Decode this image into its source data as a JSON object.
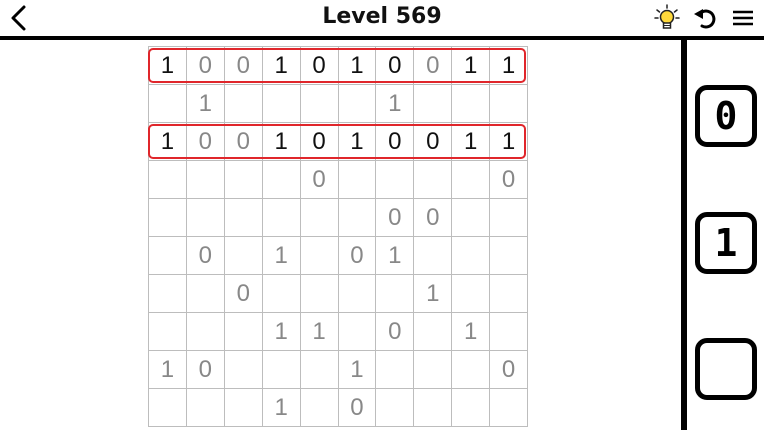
{
  "header": {
    "title": "Level 569",
    "back_icon": "chevron-left-icon",
    "hint_icon": "lightbulb-icon",
    "undo_icon": "undo-icon",
    "menu_icon": "hamburger-menu-icon"
  },
  "grid": {
    "rows": [
      [
        "1",
        "0",
        "0",
        "1",
        "0",
        "1",
        "0",
        "0",
        "1",
        "1"
      ],
      [
        "",
        "1",
        "",
        "",
        "",
        "",
        "1",
        "",
        "",
        ""
      ],
      [
        "1",
        "0",
        "0",
        "1",
        "0",
        "1",
        "0",
        "0",
        "1",
        "1"
      ],
      [
        "",
        "",
        "",
        "",
        "0",
        "",
        "",
        "",
        "",
        "0"
      ],
      [
        "",
        "",
        "",
        "",
        "",
        "",
        "0",
        "0",
        "",
        ""
      ],
      [
        "",
        "0",
        "",
        "1",
        "",
        "0",
        "1",
        "",
        "",
        ""
      ],
      [
        "",
        "",
        "0",
        "",
        "",
        "",
        "",
        "1",
        "",
        ""
      ],
      [
        "",
        "",
        "",
        "1",
        "1",
        "",
        "0",
        "",
        "1",
        ""
      ],
      [
        "1",
        "0",
        "",
        "",
        "",
        "1",
        "",
        "",
        "",
        "0"
      ],
      [
        "",
        "",
        "",
        "1",
        "",
        "0",
        "",
        "",
        "",
        ""
      ]
    ],
    "player_filled": [
      [
        0,
        0
      ],
      [
        0,
        3
      ],
      [
        0,
        4
      ],
      [
        0,
        5
      ],
      [
        0,
        6
      ],
      [
        0,
        8
      ],
      [
        0,
        9
      ],
      [
        2,
        0
      ],
      [
        2,
        3
      ],
      [
        2,
        4
      ],
      [
        2,
        5
      ],
      [
        2,
        6
      ],
      [
        2,
        7
      ],
      [
        2,
        8
      ],
      [
        2,
        9
      ]
    ],
    "highlighted_rows": [
      0,
      2
    ],
    "highlight_color": "#e0262b"
  },
  "keypad": {
    "zero_label": "0",
    "one_label": "1",
    "blank_label": ""
  }
}
